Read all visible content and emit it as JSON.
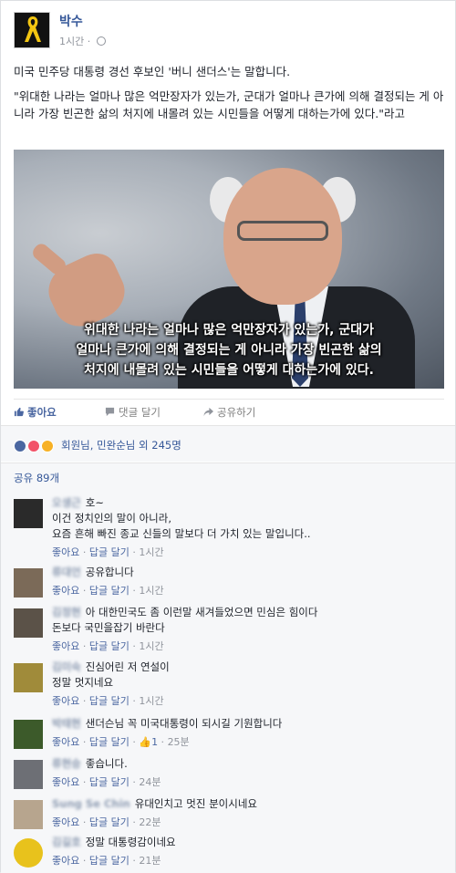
{
  "post": {
    "author": "박수",
    "time": "1시간",
    "text_line1": "미국 민주당 대통령 경선 후보인 '버니 샌더스'는 말합니다.",
    "text_quote": "\"위대한 나라는 얼마나 많은 억만장자가 있는가, 군대가 얼마나 큰가에 의해 결정되는 게 아니라 가장 빈곤한 삶의 처지에 내몰려 있는 시민들을 어떻게 대하는가에 있다.\"라고",
    "image_caption_1": "위대한 나라는 얼마나 많은 억만장자가 있는가, 군대가",
    "image_caption_2": "얼마나 큰가에 의해 결정되는 게 아니라 가장 빈곤한 삶의",
    "image_caption_3": "처지에 내몰려 있는 시민들을 어떻게 대하는가에 있다."
  },
  "actions": {
    "like": "좋아요",
    "comment": "댓글 달기",
    "share": "공유하기"
  },
  "reactions": {
    "text": "회원님, 민완순님 외 245명"
  },
  "shares": {
    "text": "공유 89개"
  },
  "comment_actions": {
    "like": "좋아요",
    "reply": "답글 달기"
  },
  "comments": [
    {
      "name": "오생근",
      "text1": "호~",
      "text2": "이건 정치인의 말이 아니라,",
      "text3": "요즘 흔해 빠진 종교 신들의 말보다 더 가치 있는 말입니다..",
      "time": "1시간",
      "avatar_color": "#2a2a2a"
    },
    {
      "name": "류대언",
      "text1": "공유합니다",
      "time": "1시간",
      "avatar_color": "#7b6a58"
    },
    {
      "name": "김정현",
      "text1": "아 대한민국도 좀 이런말 새겨들었으면 민심은 힘이다",
      "text2": "돈보다 국민을잡기 바란다",
      "time": "1시간",
      "avatar_color": "#5b5248"
    },
    {
      "name": "김미숙",
      "text1": "진심어린 저 연설이",
      "text2": "정말 멋지네요",
      "time": "1시간",
      "avatar_color": "#a08b3a"
    },
    {
      "name": "박태현",
      "text1": "샌더슨님 꼭 미국대통령이 되시길 기원합니다",
      "time": "25분",
      "likes": "1",
      "avatar_color": "#3c5a2a"
    },
    {
      "name": "류현승",
      "text1": "좋습니다.",
      "time": "24분",
      "avatar_color": "#6d6f75"
    },
    {
      "name": "Sung Se Chin",
      "text1": "유대인치고 멋진 분이시네요",
      "time": "22분",
      "avatar_color": "#b7a58e"
    },
    {
      "name": "김길호",
      "text1": "정말 대통령감이네요",
      "time": "21분",
      "avatar_color": "#e8c21c"
    }
  ]
}
